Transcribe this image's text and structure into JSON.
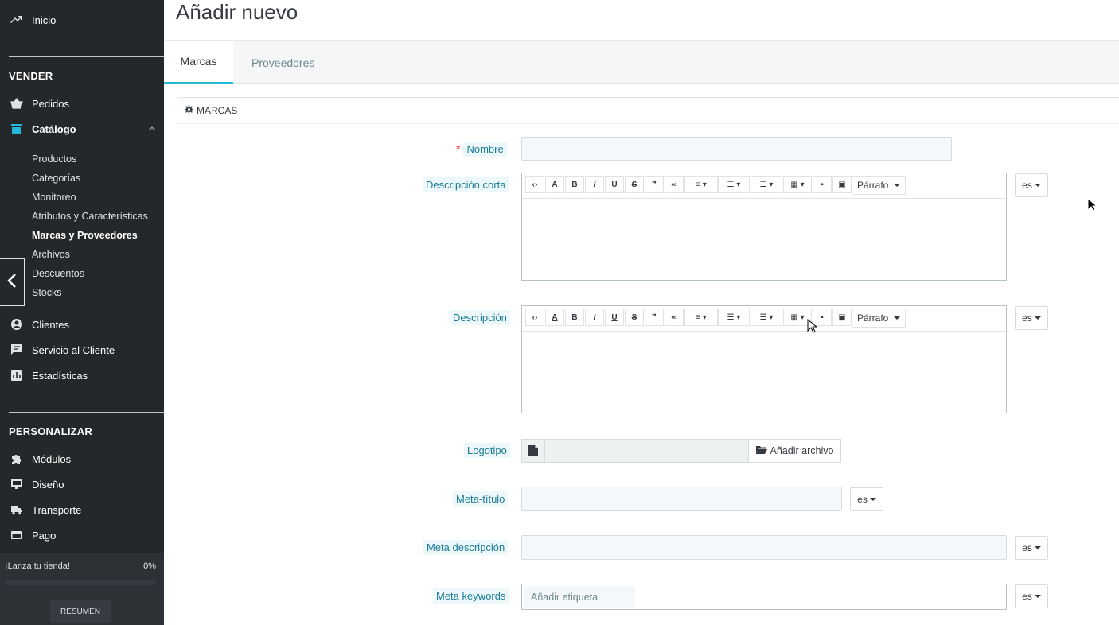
{
  "sidebar": {
    "home": "Inicio",
    "sell_title": "VENDER",
    "orders": "Pedidos",
    "catalog": "Catálogo",
    "catalog_items": [
      "Productos",
      "Categorías",
      "Monitoreo",
      "Atributos y Características",
      "Marcas y Proveedores",
      "Archivos",
      "Descuentos",
      "Stocks"
    ],
    "clients": "Clientes",
    "customer_service": "Servicio al Cliente",
    "stats": "Estadísticas",
    "customize_title": "PERSONALIZAR",
    "modules": "Módulos",
    "design": "Diseño",
    "shipping": "Transporte",
    "payment": "Pago",
    "launch_label": "¡Lanza tu tienda!",
    "launch_percent": "0%",
    "launch_progress": 0,
    "summary_button": "RESUMEN"
  },
  "header": {
    "title": "Añadir nuevo"
  },
  "tabs": [
    {
      "label": "Marcas",
      "active": true
    },
    {
      "label": "Proveedores",
      "active": false
    }
  ],
  "panel": {
    "heading": "MARCAS"
  },
  "form": {
    "name_label": "Nombre",
    "required_mark": "*",
    "short_desc_label": "Descripción corta",
    "desc_label": "Descripción",
    "logo_label": "Logotipo",
    "add_file_button": "Añadir archivo",
    "meta_title_label": "Meta-título",
    "meta_desc_label": "Meta descripción",
    "meta_keywords_label": "Meta keywords",
    "tag_placeholder": "Añadir etiqueta",
    "lang": "es",
    "paragraph_select": "Párrafo"
  },
  "colors": {
    "sidebar_bg": "#25282b",
    "accent": "#25b9d7",
    "label_text": "#1d7b98"
  }
}
